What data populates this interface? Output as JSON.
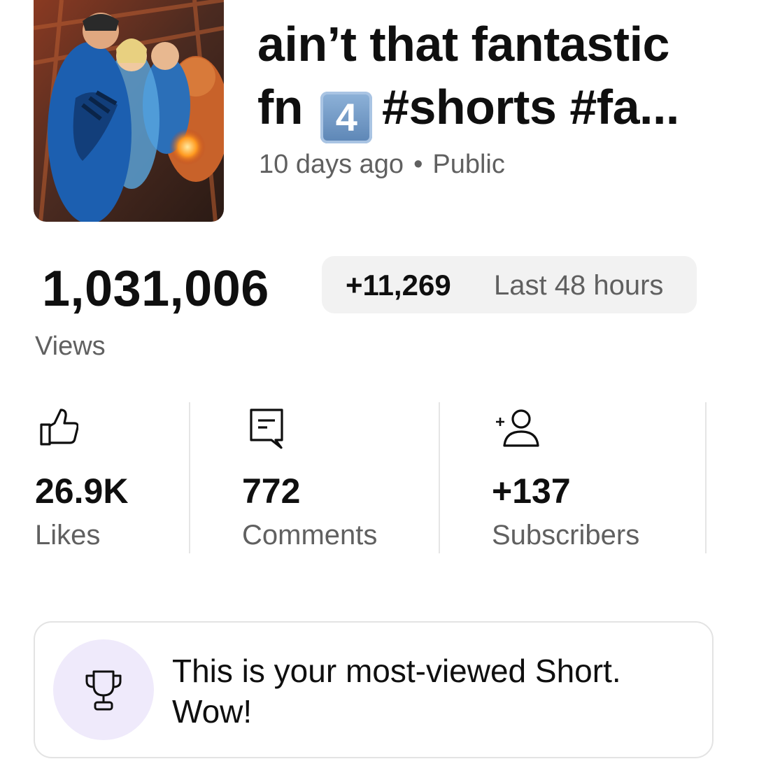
{
  "video": {
    "title_line1": "ain’t that fantastic",
    "title_line2_prefix": "fn",
    "title_keycap": "4",
    "title_line2_suffix": "#shorts #fa...",
    "age": "10 days ago",
    "separator": "•",
    "visibility": "Public",
    "thumbnail_icon": "fantastic-four-comic-art"
  },
  "views": {
    "count": "1,031,006",
    "label": "Views",
    "delta": "+11,269",
    "delta_period": "Last 48 hours"
  },
  "stats": [
    {
      "icon": "thumbs-up-icon",
      "value": "26.9K",
      "label": "Likes"
    },
    {
      "icon": "comment-icon",
      "value": "772",
      "label": "Comments"
    },
    {
      "icon": "add-person-icon",
      "value": "+137",
      "label": "Subscribers"
    }
  ],
  "achievement": {
    "icon": "trophy-icon",
    "message": "This is your most-viewed Short. Wow!",
    "badge_color": "#efeafb"
  }
}
